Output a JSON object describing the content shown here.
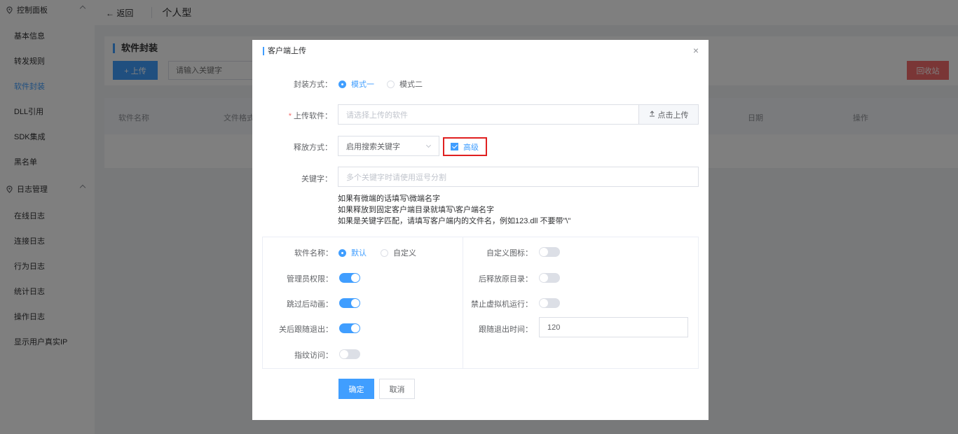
{
  "sidebar": {
    "groups": [
      {
        "label": "控制面板",
        "icon": "location-icon"
      },
      {
        "label": "日志管理",
        "icon": "location-icon"
      }
    ],
    "control_items": [
      {
        "label": "基本信息"
      },
      {
        "label": "转发规则"
      },
      {
        "label": "软件封装",
        "active": true
      },
      {
        "label": "DLL引用"
      },
      {
        "label": "SDK集成"
      },
      {
        "label": "黑名单"
      }
    ],
    "log_items": [
      {
        "label": "在线日志"
      },
      {
        "label": "连接日志"
      },
      {
        "label": "行为日志"
      },
      {
        "label": "统计日志"
      },
      {
        "label": "操作日志"
      },
      {
        "label": "显示用户真实IP"
      }
    ]
  },
  "topbar": {
    "back_label": "← 返回",
    "page_title": "个人型"
  },
  "card": {
    "title": "软件封装",
    "upload_label": "+ 上传",
    "search_placeholder": "请输入关键字",
    "recycle_label": "回收站"
  },
  "table": {
    "columns": [
      "软件名称",
      "文件格式",
      "日期",
      "操作"
    ]
  },
  "dialog": {
    "title": "客户端上传",
    "close_icon": "×",
    "pack_mode": {
      "label": "封装方式：",
      "options": [
        "模式一",
        "模式二"
      ],
      "selected": "模式一"
    },
    "upload_software": {
      "label": "上传软件：",
      "placeholder": "请选择上传的软件",
      "button": "点击上传"
    },
    "release_mode": {
      "label": "释放方式：",
      "value": "启用搜索关键字",
      "advanced_label": "高级",
      "advanced_checked": true
    },
    "keyword": {
      "label": "关键字：",
      "placeholder": "多个关键字时请使用逗号分割",
      "hints": [
        "如果有微端的话填写\\微端名字",
        "如果释放到固定客户端目录就填写\\客户端名字",
        "如果是关键字匹配，请填写客户端内的文件名，例如123.dll 不要带\"\\\""
      ]
    },
    "options": {
      "software_name": {
        "label": "软件名称：",
        "options": [
          "默认",
          "自定义"
        ],
        "selected": "默认"
      },
      "admin_permission": {
        "label": "管理员权限：",
        "on": true
      },
      "skip_animation": {
        "label": "跳过后动画：",
        "on": true
      },
      "follow_exit": {
        "label": "关后跟随退出：",
        "on": true
      },
      "fingerprint_access": {
        "label": "指纹访问：",
        "on": false
      },
      "custom_icon": {
        "label": "自定义图标：",
        "on": false
      },
      "release_original_dir": {
        "label": "后释放原目录：",
        "on": false
      },
      "block_vm": {
        "label": "禁止虚拟机运行：",
        "on": false
      },
      "follow_exit_time": {
        "label": "跟随退出时间：",
        "value": "120"
      }
    },
    "confirm_label": "确定",
    "cancel_label": "取消"
  }
}
